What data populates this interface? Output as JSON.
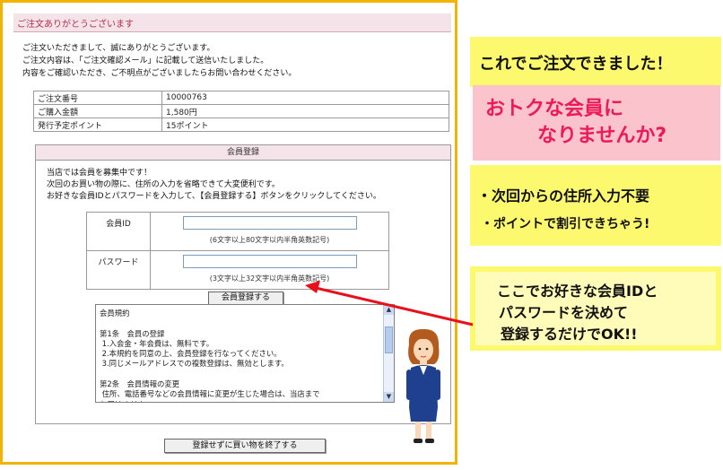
{
  "page": {
    "title": "ご注文ありがとうございます",
    "intro_lines": [
      "ご注文いただきまして、誠にありがとうございます。",
      "ご注文内容は、「ご注文確認メール」に記載して送信いたしました。",
      "内容をご確認いただき、ご不明点がございましたらお問い合わせください。"
    ]
  },
  "order": {
    "rows": [
      {
        "label": "ご注文番号",
        "value": "10000763"
      },
      {
        "label": "ご購入金額",
        "value": "1,580円"
      },
      {
        "label": "発行予定ポイント",
        "value": "15ポイント"
      }
    ]
  },
  "register": {
    "title": "会員登録",
    "lead_lines": [
      "当店では会員を募集中です！",
      "次回のお買い物の際に、住所の入力を省略できて大変便利です。",
      "お好きな会員IDとパスワードを入力して、【会員登録する】ボタンをクリックしてください。"
    ],
    "id_label": "会員ID",
    "id_value": "",
    "id_hint": "(6文字以上80文字以内半角英数記号)",
    "pw_label": "パスワード",
    "pw_value": "",
    "pw_hint": "(3文字以上32文字以内半角英数記号)",
    "submit_label": "会員登録する",
    "terms_text": "会員規約\n\n第1条　会員の登録\n 1.入会金・年会費は、無料です。\n 2.本規約を同意の上、会員登録を行なってください。\n 3.同じメールアドレスでの複数登録は、無効とします。\n\n第2条　会員情報の変更\n 住所、電話番号などの会員情報に変更が生じた場合は、当店まで\nお届けください。",
    "skip_label": "登録せずに買い物を終了する"
  },
  "callouts": {
    "done": "これでご注文できました！",
    "offer_line1": "おトクな会員に",
    "offer_line2": "なりませんか?",
    "benefit1": "・次回からの住所入力不要",
    "benefit2": "・ポイントで割引できちゃう!",
    "howto_line1": "ここでお好きな会員IDと",
    "howto_line2": "パスワードを決めて",
    "howto_line3": "登録するだけでOK!!"
  },
  "colors": {
    "frame": "#f2b400",
    "title_bg": "#f5e3ea",
    "callout_yellow": "#fdf96e",
    "callout_pink": "#fbc3cb",
    "offer_text": "#ec1a5a",
    "arrow": "#e8101a"
  }
}
